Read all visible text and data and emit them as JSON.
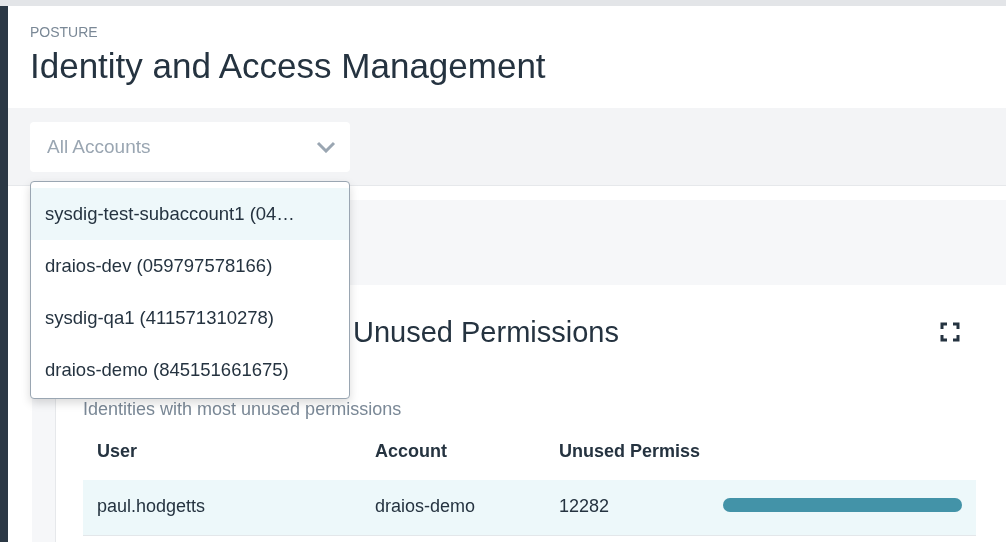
{
  "header": {
    "section": "POSTURE",
    "title": "Identity and Access Management"
  },
  "account_select": {
    "placeholder": "All Accounts",
    "expanded": true,
    "options": [
      {
        "label": "sysdig-test-subaccount1 (04…",
        "selected": true
      },
      {
        "label": "draios-dev (059797578166)",
        "selected": false
      },
      {
        "label": "sysdig-qa1 (411571310278)",
        "selected": false
      },
      {
        "label": "draios-demo (845151661675)",
        "selected": false
      }
    ]
  },
  "card": {
    "title": "Unused Permissions",
    "subtitle": "Identities with most unused permissions",
    "table": {
      "columns": [
        "User",
        "Account",
        "Unused Permiss"
      ],
      "rows": [
        {
          "user": "paul.hodgetts",
          "account": "draios-demo",
          "unused": "12282",
          "level": 1,
          "selected": true
        }
      ]
    }
  }
}
